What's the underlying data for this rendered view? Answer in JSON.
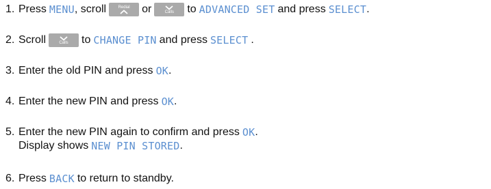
{
  "steps": [
    {
      "number": "1.",
      "t1": "Press",
      "d1": "MENU",
      "t2": ", scroll",
      "key_redial_label": "Redial",
      "t3": "or",
      "key_calls_label": "Calls",
      "t4": "to",
      "d2": "ADVANCED SET",
      "t5": "and press",
      "d3": "SELECT",
      "t6": "."
    },
    {
      "number": "2.",
      "t1": "Scroll",
      "key_calls_label": "Calls",
      "t2": "to",
      "d1": "CHANGE PIN",
      "t3": "and press",
      "d2": "SELECT",
      "t4": "."
    },
    {
      "number": "3.",
      "t1": "Enter the old PIN and press",
      "d1": "OK",
      "t2": "."
    },
    {
      "number": "4.",
      "t1": "Enter the new PIN and press",
      "d1": "OK",
      "t2": "."
    },
    {
      "number": "5.",
      "t1": "Enter the new PIN again to confirm and press",
      "d1": "OK",
      "t2": ".",
      "t3": "Display shows",
      "d2": "NEW PIN STORED",
      "t4": "."
    },
    {
      "number": "6.",
      "t1": "Press",
      "d1": "BACK",
      "t2": "to return to standby."
    }
  ],
  "colors": {
    "display_text": "#5b8fd0",
    "key_background": "#aaaaaa",
    "body_text": "#111111"
  },
  "icons": {
    "redial_key": "chevron-up-icon",
    "calls_key": "chevron-down-icon"
  }
}
